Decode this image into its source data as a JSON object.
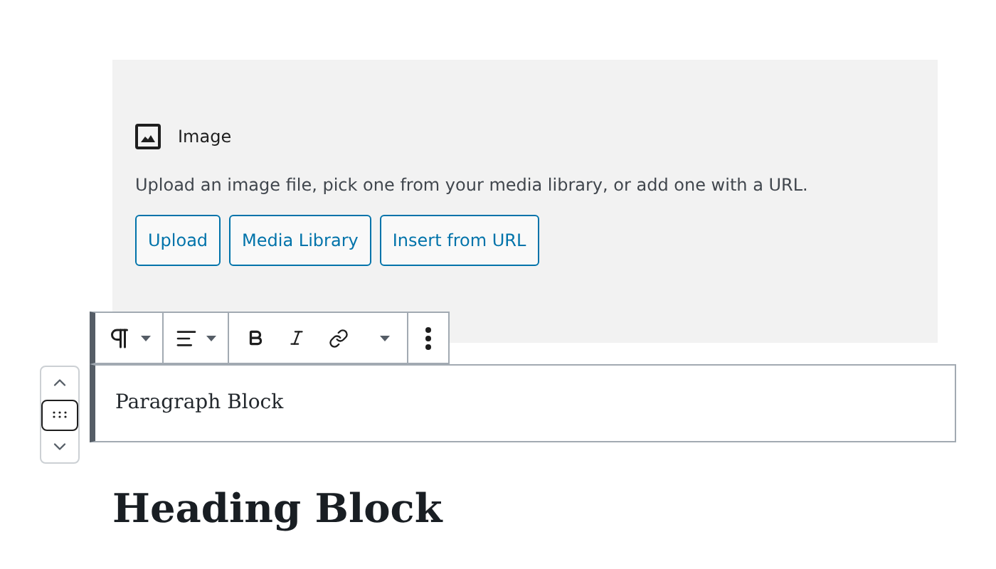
{
  "image_block": {
    "title": "Image",
    "instructions": "Upload an image file, pick one from your media library, or add one with a URL.",
    "buttons": [
      "Upload",
      "Media Library",
      "Insert from URL"
    ]
  },
  "paragraph_block": {
    "text": "Paragraph Block",
    "selected": true
  },
  "heading_block": {
    "text": "Heading Block"
  }
}
